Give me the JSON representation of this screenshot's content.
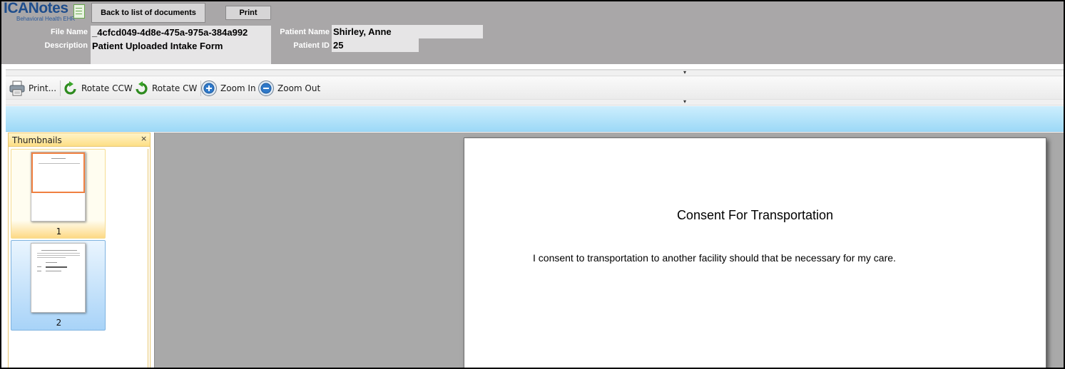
{
  "header": {
    "logo": {
      "brand": "ICANotes",
      "tagline": "Behavioral Health EHR"
    },
    "back_button": "Back to list of documents",
    "print_button": "Print",
    "file_name_label": "File Name",
    "file_name": "_4cfcd049-4d8e-475a-975a-384a992",
    "description_label": "Description",
    "description": "Patient Uploaded Intake Form",
    "patient_name_label": "Patient Name",
    "patient_name": "Shirley, Anne",
    "patient_id_label": "Patient ID",
    "patient_id": "25"
  },
  "toolbar": {
    "print": "Print...",
    "rotate_ccw": "Rotate CCW",
    "rotate_cw": "Rotate CW",
    "zoom_in": "Zoom In",
    "zoom_out": "Zoom Out",
    "icons": [
      "printer-icon",
      "rotate-ccw-icon",
      "rotate-cw-icon",
      "zoom-in-icon",
      "zoom-out-icon"
    ]
  },
  "thumbnails": {
    "title": "Thumbnails",
    "close": "×",
    "pages": [
      {
        "number": "1",
        "state": "current"
      },
      {
        "number": "2",
        "state": "selected"
      }
    ]
  },
  "document": {
    "title": "Consent For Transportation",
    "body": "I consent to transportation to another facility should that be necessary for my care."
  },
  "colors": {
    "header_bg": "#a9a7a8",
    "band_blue": "#9dd9f7",
    "thumb_current": "#fdd985",
    "thumb_selected": "#a8d3f8",
    "viewer_bg": "#a9a9a9"
  }
}
